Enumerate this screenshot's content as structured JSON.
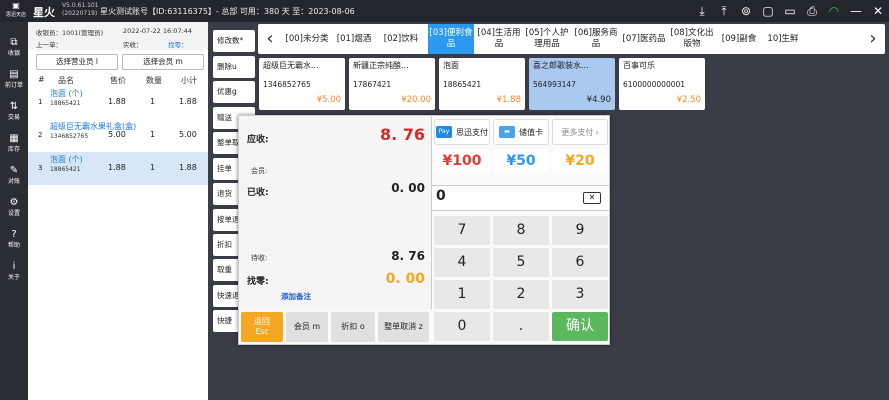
{
  "title_bar": {
    "logo_label": "思迅天店",
    "app_name": "星火",
    "version": "V5.0.61.101",
    "build": "(20220719)",
    "info": "星火测试账号【ID:63116375】- 总部 可用：380 天 至：2023-08-06",
    "icons": [
      "download-icon",
      "upload-icon",
      "printer-icon",
      "settings-icon",
      "print-icon",
      "wifi-icon",
      "minimize-icon",
      "close-icon"
    ]
  },
  "sidebar": {
    "items": [
      {
        "label": "收银",
        "icon": "cashier-icon"
      },
      {
        "label": "前订单",
        "icon": "orders-icon"
      },
      {
        "label": "交易",
        "icon": "trade-icon"
      },
      {
        "label": "库存",
        "icon": "inventory-icon"
      },
      {
        "label": "对账",
        "icon": "reconcile-icon"
      },
      {
        "label": "设置",
        "icon": "gear-icon"
      },
      {
        "label": "帮助",
        "icon": "help-icon"
      },
      {
        "label": "关于",
        "icon": "info-icon"
      }
    ]
  },
  "order_panel": {
    "cashier": "收银员：1001(管理员)",
    "datetime": "2022-07-22 16:07:44",
    "last_order": "上一单：",
    "received": "实收：",
    "change": "找零：",
    "select_salesman": "选择营业员 l",
    "select_member": "选择会员 m",
    "columns": [
      "#",
      "品名",
      "售价",
      "数量",
      "小计"
    ],
    "rows": [
      {
        "index": "1",
        "name": "泡面 (个)",
        "barcode": "18865421",
        "price": "1.88",
        "qty": "1",
        "subtotal": "1.88"
      },
      {
        "index": "2",
        "name": "超级巨无霸水果礼盒(盒)",
        "barcode": "1346852765",
        "price": "5.00",
        "qty": "1",
        "subtotal": "5.00"
      },
      {
        "index": "3",
        "name": "泡面 (个)",
        "barcode": "18865421",
        "price": "1.88",
        "qty": "1",
        "subtotal": "1.88"
      }
    ]
  },
  "function_buttons": [
    "修改数*",
    "删除u",
    "优惠g",
    "赠送",
    "整单取",
    "挂单",
    "退货",
    "按单退",
    "折扣",
    "取重",
    "快速退",
    "快捷"
  ],
  "categories": [
    {
      "label": "[00]未分类",
      "active": false
    },
    {
      "label": "[01]烟酒",
      "active": false
    },
    {
      "label": "[02]饮料",
      "active": false
    },
    {
      "label": "[03]便利食品",
      "active": true
    },
    {
      "label": "[04]生活用品",
      "active": false
    },
    {
      "label": "[05]个人护理用品",
      "active": false
    },
    {
      "label": "[06]服务商品",
      "active": false
    },
    {
      "label": "[07]医药品",
      "active": false
    },
    {
      "label": "[08]文化出版物",
      "active": false
    },
    {
      "label": "[09]副食",
      "active": false
    },
    {
      "label": "10]生鲜",
      "active": false
    }
  ],
  "products": [
    {
      "name": "超级巨无霸水...",
      "code": "1346852765",
      "price": "¥5.00",
      "selected": false
    },
    {
      "name": "新疆正宗纯酿...",
      "code": "17867421",
      "price": "¥20.00",
      "selected": false
    },
    {
      "name": "泡面",
      "code": "18865421",
      "price": "¥1.88",
      "selected": false
    },
    {
      "name": "喜之郎歌装水...",
      "code": "564993147",
      "price": "¥4.90",
      "selected": true
    },
    {
      "name": "百事可乐",
      "code": "6100000000001",
      "price": "¥2.50",
      "selected": false
    }
  ],
  "checkout": {
    "due_label": "应收:",
    "due_value": "8. 76",
    "member_label": "会员:",
    "paid_label": "已收:",
    "paid_value": "0. 00",
    "pending_label": "待收:",
    "pending_value": "8. 76",
    "change_label": "找零:",
    "change_value": "0. 00",
    "add_note": "添加备注",
    "pay_methods": [
      "思迅支付",
      "储值卡",
      "更多支付"
    ],
    "pay_icon_text": "Pay",
    "cash_buttons": [
      "¥100",
      "¥50",
      "¥20"
    ],
    "input_value": "0",
    "keys": [
      "7",
      "8",
      "9",
      "4",
      "5",
      "6",
      "1",
      "2",
      "3",
      "0",
      "."
    ],
    "confirm_label": "确认",
    "bottom": {
      "return_label": "返回",
      "return_key": "Esc",
      "member": "会员 m",
      "discount": "折扣 o",
      "cancel_order": "整单取消 z"
    },
    "colors": {
      "due": "#d62b2b",
      "change": "#f5a623",
      "cash_100": "#e53935",
      "cash_50": "#2d98ef",
      "cash_20": "#f5a623",
      "confirm": "#5cb85c",
      "note": "#1e5bd6"
    }
  }
}
